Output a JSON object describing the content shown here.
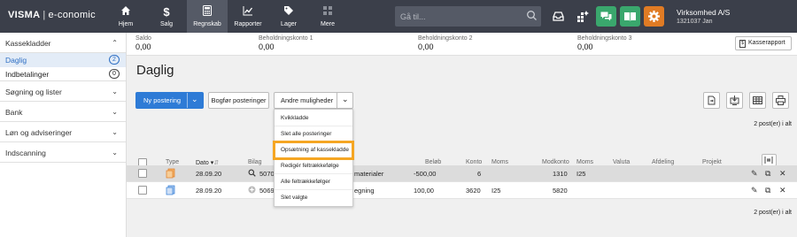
{
  "brand": {
    "logo": "VISMA",
    "product": "e-conomic"
  },
  "nav": [
    {
      "label": "Hjem",
      "icon": "home-icon"
    },
    {
      "label": "Salg",
      "icon": "dollar-icon"
    },
    {
      "label": "Regnskab",
      "icon": "calculator-icon",
      "active": true
    },
    {
      "label": "Rapporter",
      "icon": "chart-icon"
    },
    {
      "label": "Lager",
      "icon": "tag-icon"
    },
    {
      "label": "Mere",
      "icon": "grid-icon"
    }
  ],
  "search": {
    "placeholder": "Gå til..."
  },
  "company": {
    "name": "Virksomhed A/S",
    "id": "1321037 Jan"
  },
  "colors": {
    "green": "#3aa76d",
    "orange": "#e07b24",
    "blue": "#2e7bd6",
    "highlight": "#f5a623"
  },
  "sidebar": {
    "kassekladder": "Kassekladder",
    "items": [
      {
        "label": "Daglig",
        "count": "2"
      },
      {
        "label": "Indbetalinger",
        "count": "0"
      }
    ],
    "sections": [
      "Søgning og lister",
      "Bank",
      "Løn og adviseringer",
      "Indscanning"
    ]
  },
  "balances": [
    {
      "label": "Saldo",
      "value": "0,00"
    },
    {
      "label": "Beholdningskonto 1",
      "value": "0,00"
    },
    {
      "label": "Beholdningskonto 2",
      "value": "0,00"
    },
    {
      "label": "Beholdningskonto 3",
      "value": "0,00"
    }
  ],
  "kasserapport": "Kasserapport",
  "page_title": "Daglig",
  "toolbar": {
    "ny_postering": "Ny postering",
    "bogfor": "Bogfør posteringer",
    "andre": "Andre muligheder"
  },
  "count_label": "2 post(er) i alt",
  "columns": [
    "Type",
    "Dato",
    "Bilag",
    "Beløb",
    "Konto",
    "Moms",
    "Modkonto",
    "Moms",
    "Valuta",
    "Afdeling",
    "Projekt"
  ],
  "rows": [
    {
      "dato": "28.09.20",
      "bilag": "5070",
      "tekst": "materialer",
      "belob": "-500,00",
      "konto": "6",
      "moms": "",
      "modkonto": "1310",
      "moms2": "I25"
    },
    {
      "dato": "28.09.20",
      "bilag": "5069",
      "tekst": "egning",
      "belob": "100,00",
      "konto": "3620",
      "moms": "I25",
      "modkonto": "5820",
      "moms2": ""
    }
  ],
  "menu": [
    "Kvikkladde",
    "Slet alle posteringer",
    "Opsætning af kassekladde",
    "Redigér feltrækkefølge",
    "Alle feltrækkefølger",
    "Slet valgte"
  ]
}
